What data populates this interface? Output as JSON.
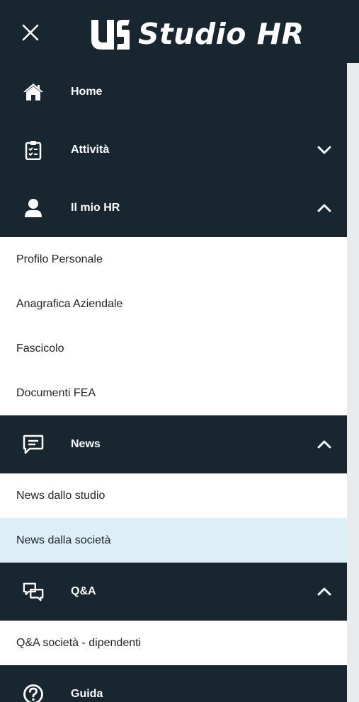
{
  "header": {
    "brand_name": "Studio HR",
    "close_icon": "close-icon",
    "logo_icon": "studio-logo-icon"
  },
  "sidebar": {
    "sections": [
      {
        "label": "Home",
        "icon": "home-icon",
        "expanded": null
      },
      {
        "label": "Attività",
        "icon": "clipboard-icon",
        "expanded": false
      },
      {
        "label": "Il mio HR",
        "icon": "user-icon",
        "expanded": true,
        "items": [
          "Profilo Personale",
          "Anagrafica Aziendale",
          "Fascicolo",
          "Documenti FEA"
        ]
      },
      {
        "label": "News",
        "icon": "message-icon",
        "expanded": true,
        "items": [
          "News dallo studio",
          "News dalla società"
        ]
      },
      {
        "label": "Q&A",
        "icon": "chat-icon",
        "expanded": true,
        "items": [
          "Q&A società - dipendenti"
        ]
      },
      {
        "label": "Guida",
        "icon": "help-icon",
        "expanded": null
      }
    ],
    "active_item": "News dalla società"
  },
  "colors": {
    "sidebar_dark": "#17262f",
    "active_bg": "#dceef8",
    "text": "#212529"
  }
}
